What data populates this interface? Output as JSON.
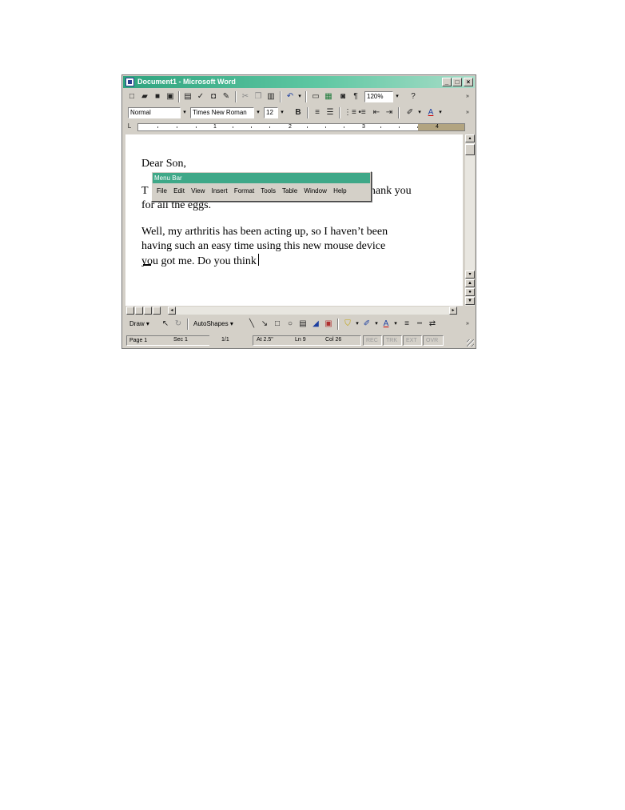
{
  "window": {
    "title": "Document1 - Microsoft Word",
    "title_bar_color": "#3fa888"
  },
  "standard_toolbar": {
    "zoom": "120%",
    "buttons": [
      "new-icon",
      "open-icon",
      "save-icon",
      "permission-icon",
      "print-icon",
      "spelling-icon",
      "print-preview-icon",
      "research-icon",
      "cut-icon",
      "copy-icon",
      "paste-icon",
      "undo-icon",
      "table-icon",
      "excel-icon",
      "drawing-icon",
      "show-formatting-icon",
      "help-icon"
    ]
  },
  "formatting_toolbar": {
    "style": "Normal",
    "font": "Times New Roman",
    "size": "12",
    "bold": "B"
  },
  "ruler": {
    "numbers": [
      "1",
      "2",
      "3",
      "4"
    ]
  },
  "document": {
    "lines": [
      "Dear Son,",
      "T",
      "thank you",
      "for all the eggs.",
      "Well, my arthritis has been acting up, so I haven’t been",
      "having such an easy time using this new mouse device",
      "you got me. Do you think"
    ]
  },
  "menu_bar": {
    "title": "Menu Bar",
    "items": [
      "File",
      "Edit",
      "View",
      "Insert",
      "Format",
      "Tools",
      "Table",
      "Window",
      "Help"
    ]
  },
  "drawing_toolbar": {
    "draw": "Draw ▾",
    "autoshapes": "AutoShapes ▾"
  },
  "status_bar": {
    "page": "Page 1",
    "section": "Sec 1",
    "pages": "1/1",
    "at": "At 2.5\"",
    "line": "Ln 9",
    "col": "Col 26",
    "rec": "REC",
    "trk": "TRK",
    "ext": "EXT",
    "ovr": "OVR"
  }
}
